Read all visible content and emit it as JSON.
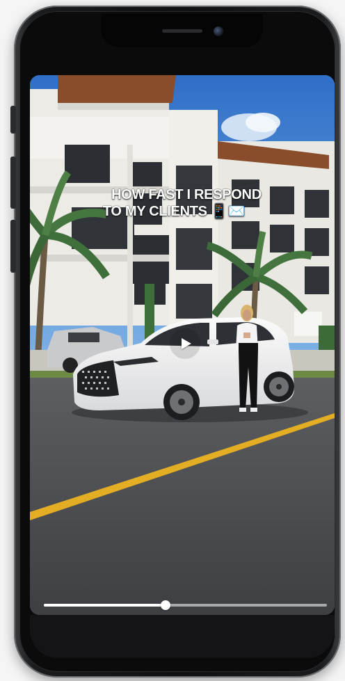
{
  "video": {
    "caption_line1": "HOW FAST I RESPOND",
    "caption_line2": "TO MY CLIENTS 📱✉️",
    "progress": 0.43,
    "state": "paused",
    "play_icon": "play-icon"
  },
  "colors": {
    "frame": "#0f1011",
    "sky": "#3f7fd0",
    "road": "#4a4c50",
    "road_line": "#e9b52a",
    "car": "#f2f2f2"
  }
}
